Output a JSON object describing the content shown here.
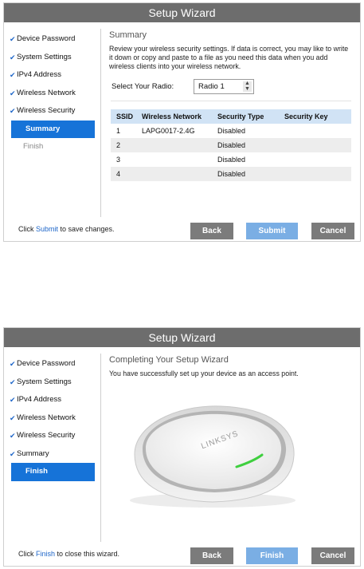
{
  "window_title": "Setup Wizard",
  "sidebar": {
    "items": [
      {
        "label": "Device Password",
        "state": "done"
      },
      {
        "label": "System Settings",
        "state": "done"
      },
      {
        "label": "IPv4 Address",
        "state": "done"
      },
      {
        "label": "Wireless Network",
        "state": "done"
      },
      {
        "label": "Wireless Security",
        "state": "done"
      },
      {
        "label": "Summary",
        "state": "active"
      },
      {
        "label": "Finish",
        "state": "pending"
      }
    ],
    "items_finish": [
      {
        "label": "Device Password",
        "state": "done"
      },
      {
        "label": "System Settings",
        "state": "done"
      },
      {
        "label": "IPv4 Address",
        "state": "done"
      },
      {
        "label": "Wireless Network",
        "state": "done"
      },
      {
        "label": "Wireless Security",
        "state": "done"
      },
      {
        "label": "Summary",
        "state": "done"
      },
      {
        "label": "Finish",
        "state": "active"
      }
    ]
  },
  "summary": {
    "title": "Summary",
    "description": "Review your wireless security settings. If data is correct, you may like to write it down or copy and paste to a file as you need this data when you add wireless clients into your wireless network.",
    "radio_label": "Select Your Radio:",
    "radio_value": "Radio 1",
    "table": {
      "headers": [
        "SSID",
        "Wireless Network",
        "Security Type",
        "Security Key"
      ],
      "rows": [
        [
          "1",
          "LAPG0017-2.4G",
          "Disabled",
          ""
        ],
        [
          "2",
          "",
          "Disabled",
          ""
        ],
        [
          "3",
          "",
          "Disabled",
          ""
        ],
        [
          "4",
          "",
          "Disabled",
          ""
        ]
      ]
    },
    "footer_prefix": "Click ",
    "footer_link": "Submit",
    "footer_suffix": " to save changes.",
    "buttons": {
      "back": "Back",
      "submit": "Submit",
      "cancel": "Cancel"
    }
  },
  "finish": {
    "title": "Completing Your Setup Wizard",
    "message": "You have successfully set up your device as an access point.",
    "device_brand": "LINKSYS",
    "footer_prefix": "Click ",
    "footer_link": "Finish",
    "footer_suffix": " to close this wizard.",
    "buttons": {
      "back": "Back",
      "finish": "Finish",
      "cancel": "Cancel"
    }
  },
  "colors": {
    "titlebar": "#6d6d6d",
    "active_nav": "#1673d8",
    "check": "#1e66c9",
    "primary_button": "#7aaee4",
    "button": "#7b7b7b",
    "table_header": "#d1e3f5",
    "device_led": "#3fcf3f"
  },
  "icons": {
    "done": "checkmark-icon",
    "spinner": "up-down-arrows-icon"
  }
}
